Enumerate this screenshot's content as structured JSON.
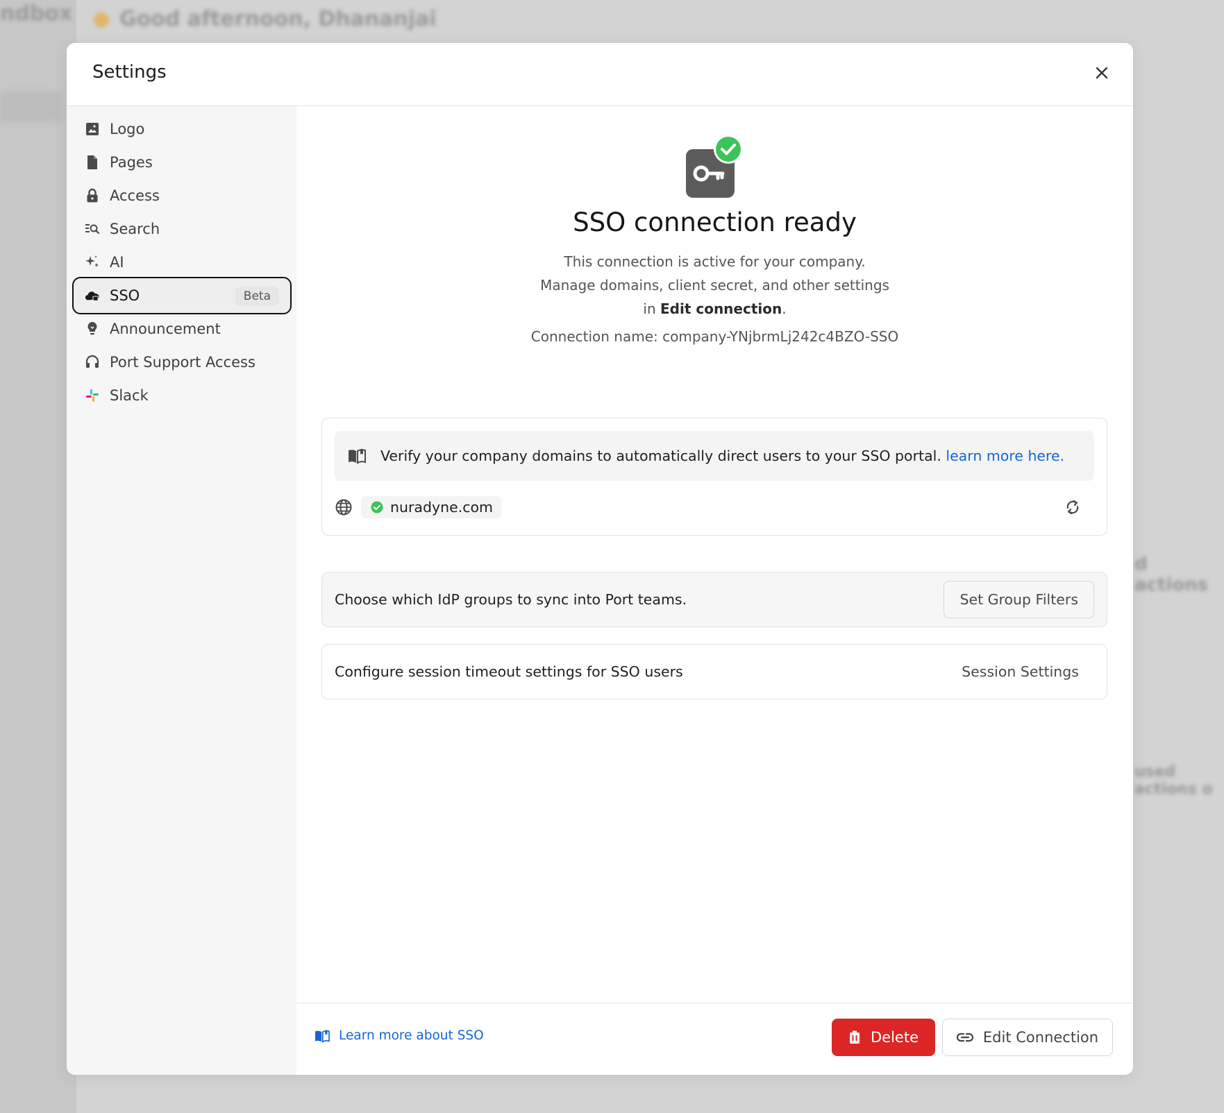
{
  "background": {
    "greeting": "Good afternoon, Dhananjai",
    "frag_top_left": "ndbox",
    "frag_right_1": "d actions",
    "frag_right_2": "used actions o"
  },
  "modal": {
    "title": "Settings",
    "close_icon": "close-icon"
  },
  "sidebar": {
    "items": [
      {
        "label": "Logo",
        "icon": "image-icon"
      },
      {
        "label": "Pages",
        "icon": "page-icon"
      },
      {
        "label": "Access",
        "icon": "lock-icon"
      },
      {
        "label": "Search",
        "icon": "search-list-icon"
      },
      {
        "label": "AI",
        "icon": "sparkles-icon"
      },
      {
        "label": "SSO",
        "icon": "cloud-lock-icon",
        "badge": "Beta",
        "active": true
      },
      {
        "label": "Announcement",
        "icon": "lightbulb-icon"
      },
      {
        "label": "Port Support Access",
        "icon": "headset-icon"
      },
      {
        "label": "Slack",
        "icon": "slack-icon"
      }
    ]
  },
  "sso": {
    "title": "SSO connection ready",
    "desc_line1": "This connection is active for your company.",
    "desc_line2": "Manage domains, client secret, and other settings",
    "desc_line3_prefix": "in ",
    "desc_line3_bold": "Edit connection",
    "desc_line3_suffix": ".",
    "connection_name": "Connection name: company-YNjbrmLj242c4BZO-SSO",
    "verify_text": "Verify your company domains to automatically direct users to your SSO portal.",
    "verify_link": "learn more here.",
    "domain": "nuradyne.com",
    "groups_text": "Choose which IdP groups to sync into Port teams.",
    "groups_button": "Set Group Filters",
    "session_text": "Configure session timeout settings for SSO users",
    "session_button": "Session Settings"
  },
  "footer": {
    "learn_link": "Learn more about SSO",
    "delete_label": "Delete",
    "edit_label": "Edit Connection"
  },
  "colors": {
    "accent_blue": "#1565d8",
    "success_green": "#3cc35a",
    "danger_red": "#dc2626"
  }
}
